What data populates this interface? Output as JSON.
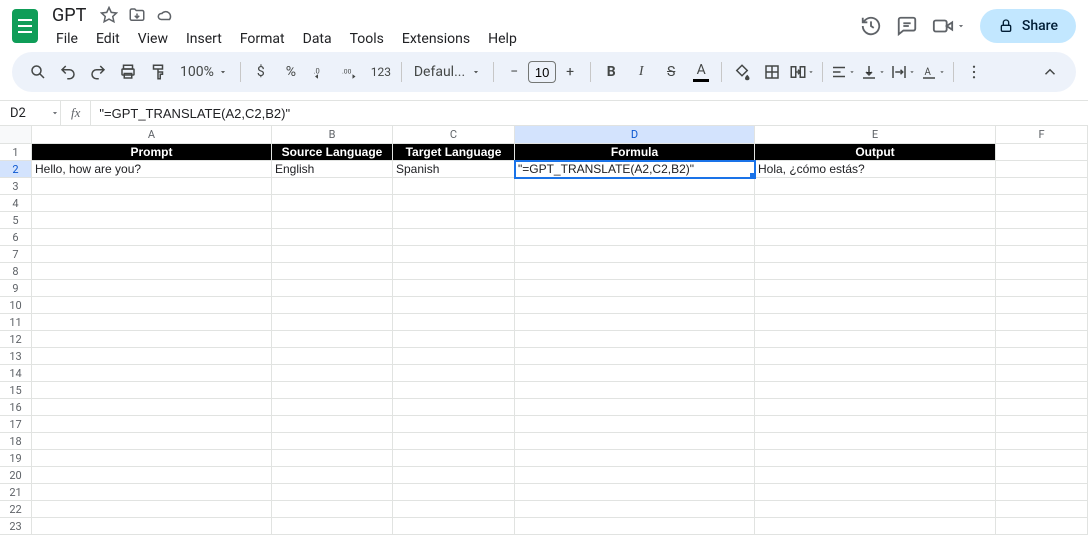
{
  "doc": {
    "title": "GPT"
  },
  "menu": {
    "file": "File",
    "edit": "Edit",
    "view": "View",
    "insert": "Insert",
    "format": "Format",
    "data": "Data",
    "tools": "Tools",
    "extensions": "Extensions",
    "help": "Help"
  },
  "header": {
    "share": "Share"
  },
  "toolbar": {
    "zoom": "100%",
    "currency": "$",
    "percent": "%",
    "num123": "123",
    "font": "Defaul...",
    "fontsize": "10",
    "minus": "−",
    "plus": "+"
  },
  "formula_bar": {
    "cellref": "D2",
    "fx": "fx",
    "text": "\"=GPT_TRANSLATE(A2,C2,B2)\""
  },
  "columns": [
    "A",
    "B",
    "C",
    "D",
    "E",
    "F"
  ],
  "header_row": {
    "A": "Prompt",
    "B": "Source Language",
    "C": "Target Language",
    "D": "Formula",
    "E": "Output"
  },
  "data_row": {
    "A": "Hello, how are you?",
    "B": "English",
    "C": "Spanish",
    "D": "\"=GPT_TRANSLATE(A2,C2,B2)\"",
    "E": "Hola, ¿cómo estás?"
  },
  "selected": {
    "col": "D",
    "row": 2
  },
  "row_count": 23
}
